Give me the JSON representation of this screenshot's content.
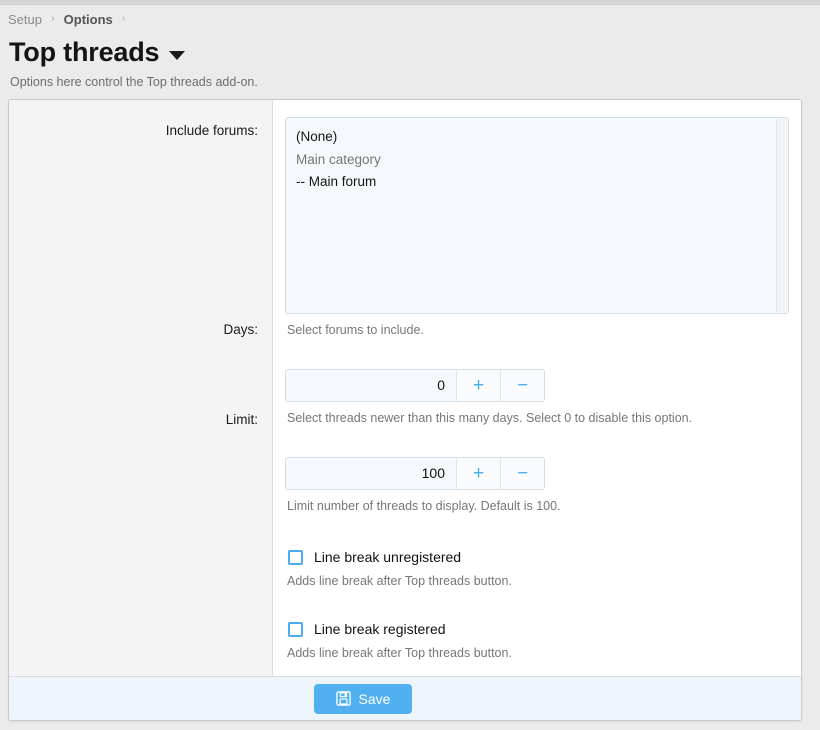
{
  "breadcrumb": {
    "items": [
      {
        "label": "Setup",
        "active": false
      },
      {
        "label": "Options",
        "active": true
      }
    ],
    "separator": "›"
  },
  "header": {
    "title": "Top threads",
    "caret_icon": "chevron-down-icon",
    "description": "Options here control the Top threads add-on."
  },
  "form": {
    "rows": [
      {
        "label": "Include forums:",
        "type": "multiselect",
        "options": [
          {
            "text": "(None)",
            "group": false
          },
          {
            "text": "Main category",
            "group": true
          },
          {
            "text": "-- Main forum",
            "group": false
          }
        ],
        "hint": "Select forums to include."
      },
      {
        "label": "Days:",
        "type": "stepper",
        "value": "0",
        "increment_label": "+",
        "decrement_label": "−",
        "hint": "Select threads newer than this many days. Select 0 to disable this option."
      },
      {
        "label": "Limit:",
        "type": "stepper",
        "value": "100",
        "increment_label": "+",
        "decrement_label": "−",
        "hint": "Limit number of threads to display. Default is 100."
      },
      {
        "label": "",
        "type": "checkbox",
        "checkbox_label": "Line break unregistered",
        "checked": false,
        "hint": "Adds line break after Top threads button."
      },
      {
        "label": "",
        "type": "checkbox",
        "checkbox_label": "Line break registered",
        "checked": false,
        "hint": "Adds line break after Top threads button."
      }
    ]
  },
  "footer": {
    "save_label": "Save",
    "save_icon": "floppy-disk-icon"
  },
  "colors": {
    "accent": "#51b0ef",
    "page_bg": "#ebebeb",
    "panel_bg": "#ffffff",
    "label_col_bg": "#f4f4f4",
    "field_bg": "#f5f9fd",
    "footer_bg": "#edf4fb",
    "hint_text": "#777777"
  }
}
